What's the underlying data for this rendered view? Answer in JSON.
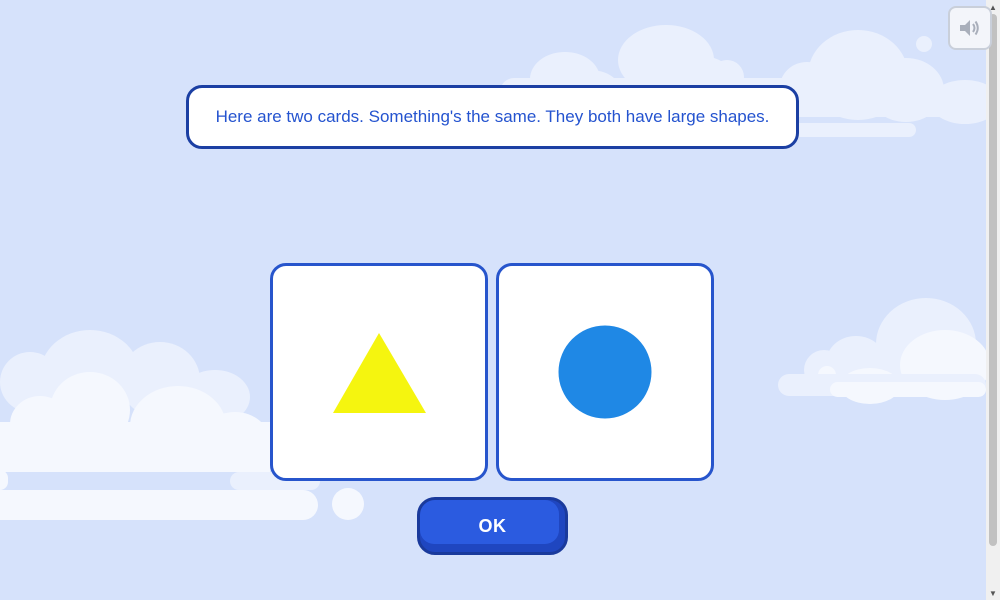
{
  "prompt": {
    "text": "Here are two cards. Something's the same. They both have large shapes."
  },
  "cards": [
    {
      "shape": "triangle",
      "size": "large",
      "color": "#f5f50f"
    },
    {
      "shape": "circle",
      "size": "large",
      "color": "#1f88e5"
    }
  ],
  "ok_button": {
    "label": "OK"
  },
  "sound_button": {
    "icon": "speaker-icon"
  },
  "colors": {
    "background": "#d6e2fb",
    "accent": "#2755cc",
    "prompt_text": "#2453cf"
  }
}
